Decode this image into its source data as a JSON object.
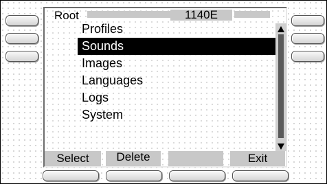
{
  "screen": {
    "header": {
      "title": "Root",
      "model": "1140E"
    },
    "menu": {
      "items": [
        {
          "label": "Profiles"
        },
        {
          "label": "Sounds"
        },
        {
          "label": "Images"
        },
        {
          "label": "Languages"
        },
        {
          "label": "Logs"
        },
        {
          "label": "System"
        }
      ],
      "selected_item": "Sounds"
    },
    "scrollbar": {
      "up_icon": "triangle-up-icon",
      "down_icon": "triangle-down-icon"
    },
    "softkeys": [
      {
        "label": "Select"
      },
      {
        "label": "Delete"
      },
      {
        "label": ""
      },
      {
        "label": "Exit"
      }
    ]
  },
  "colors": {
    "selection_background": "#000000",
    "selection_text": "#ffffff",
    "softkey_background": "#c8c8c8"
  }
}
